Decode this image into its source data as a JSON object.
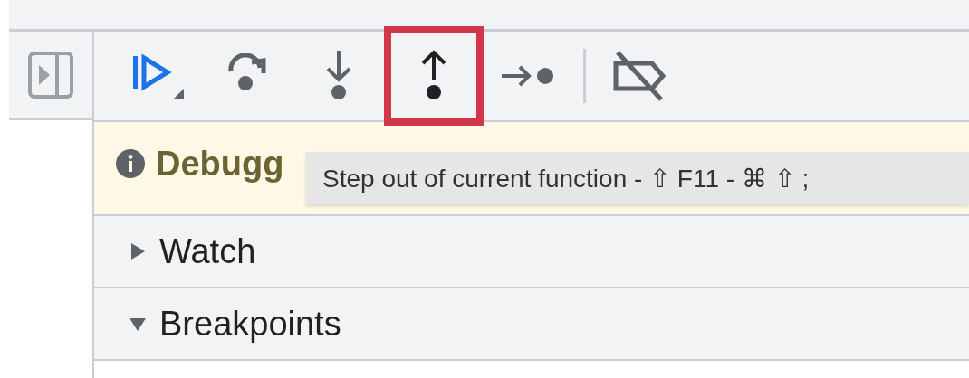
{
  "toolbar": {
    "buttons": [
      {
        "kind": "resume",
        "highlighted": false
      },
      {
        "kind": "step-over",
        "highlighted": false
      },
      {
        "kind": "step-into",
        "highlighted": false
      },
      {
        "kind": "step-out",
        "highlighted": true
      },
      {
        "kind": "step",
        "highlighted": false
      },
      {
        "kind": "deactivate",
        "highlighted": false
      }
    ]
  },
  "banner": {
    "text": "Debugg"
  },
  "tooltip": {
    "text": "Step out of current function - ⇧ F11 - ⌘ ⇧ ;"
  },
  "sections": [
    {
      "title": "Watch",
      "expanded": false
    },
    {
      "title": "Breakpoints",
      "expanded": true
    }
  ]
}
